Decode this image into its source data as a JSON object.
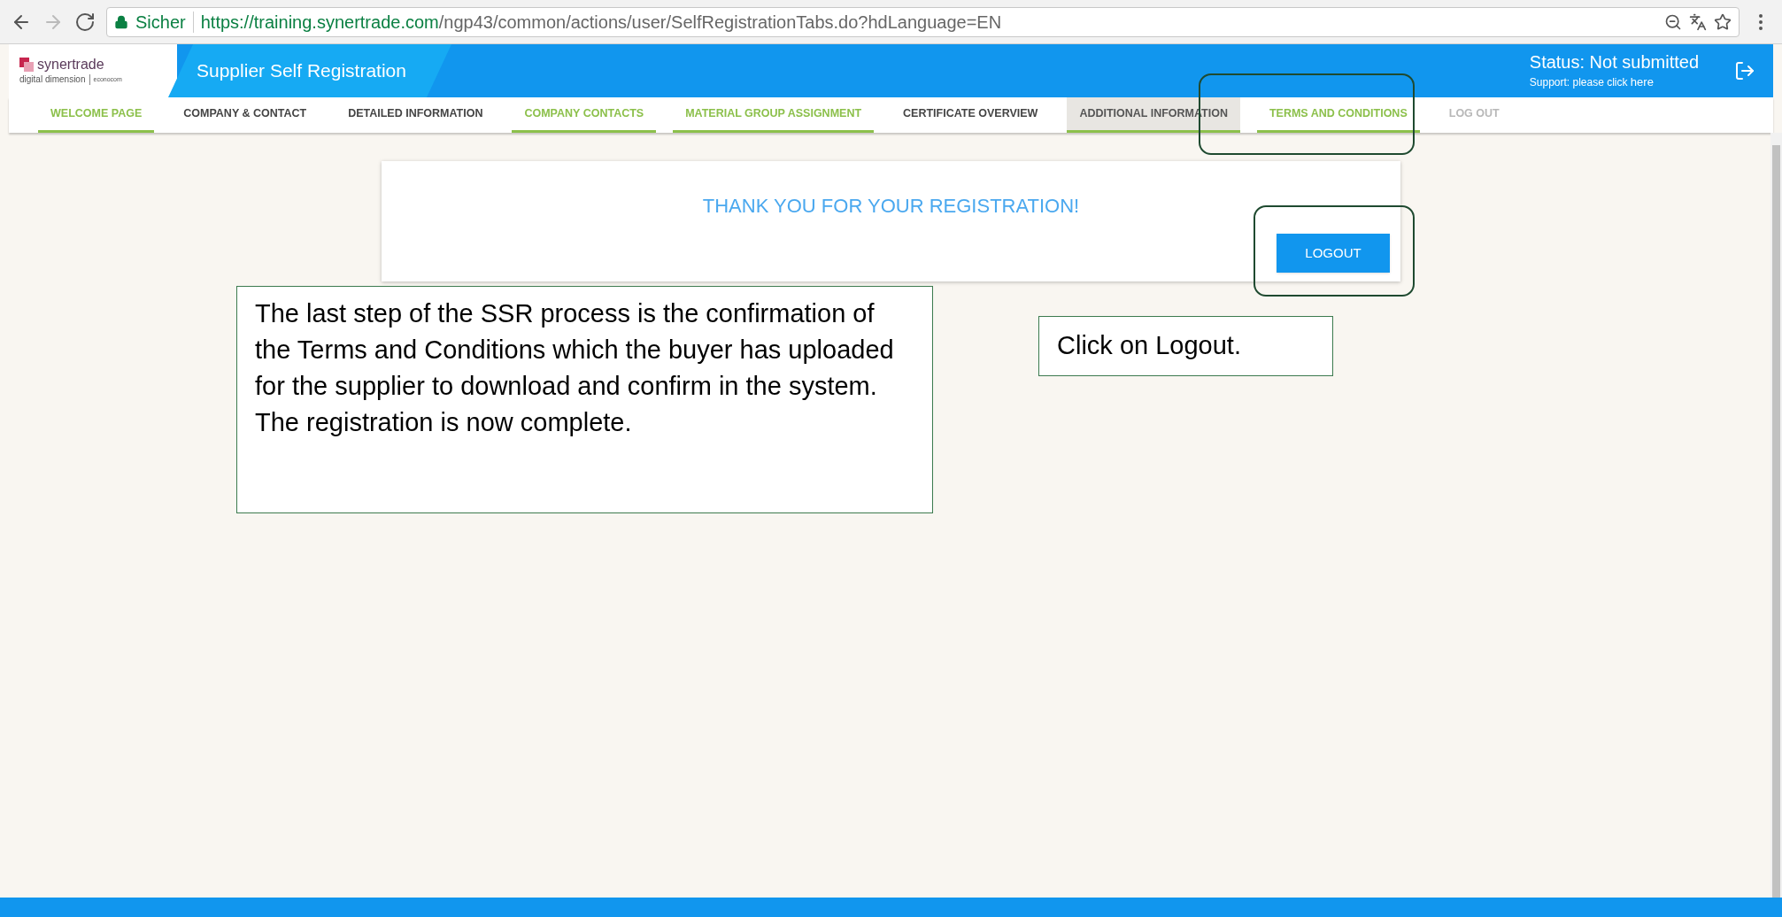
{
  "browser": {
    "security_label": "Sicher",
    "url_host": "https://training.synertrade.com",
    "url_path": "/ngp43/common/actions/user/SelfRegistrationTabs.do?hdLanguage=EN"
  },
  "header": {
    "logo_name": "synertrade",
    "logo_tagline": "digital dimension",
    "logo_partner": "econocom",
    "title": "Supplier Self Registration",
    "status": "Status: Not submitted",
    "support_prefix": "Support: please click ",
    "support_link": "here"
  },
  "tabs": [
    {
      "label": "WELCOME PAGE",
      "completed": true,
      "disabled": false,
      "selected": false
    },
    {
      "label": "COMPANY & CONTACT",
      "completed": false,
      "disabled": false,
      "selected": false
    },
    {
      "label": "DETAILED INFORMATION",
      "completed": false,
      "disabled": false,
      "selected": false
    },
    {
      "label": "COMPANY CONTACTS",
      "completed": true,
      "disabled": false,
      "selected": false
    },
    {
      "label": "MATERIAL GROUP ASSIGNMENT",
      "completed": true,
      "disabled": false,
      "selected": false
    },
    {
      "label": "CERTIFICATE OVERVIEW",
      "completed": false,
      "disabled": false,
      "selected": false
    },
    {
      "label": "ADDITIONAL INFORMATION",
      "completed": false,
      "disabled": false,
      "selected": true
    },
    {
      "label": "TERMS AND CONDITIONS",
      "completed": true,
      "disabled": false,
      "selected": false
    },
    {
      "label": "LOG OUT",
      "completed": false,
      "disabled": true,
      "selected": false
    }
  ],
  "card": {
    "message": "THANK YOU FOR YOUR REGISTRATION!",
    "button": "LOGOUT"
  },
  "callouts": [
    {
      "text": "The last step of the SSR process is the confirmation of the Terms and Conditions which the buyer has uploaded for the supplier to download and confirm in the system. The registration is now complete."
    },
    {
      "text": "Click on Logout."
    }
  ]
}
